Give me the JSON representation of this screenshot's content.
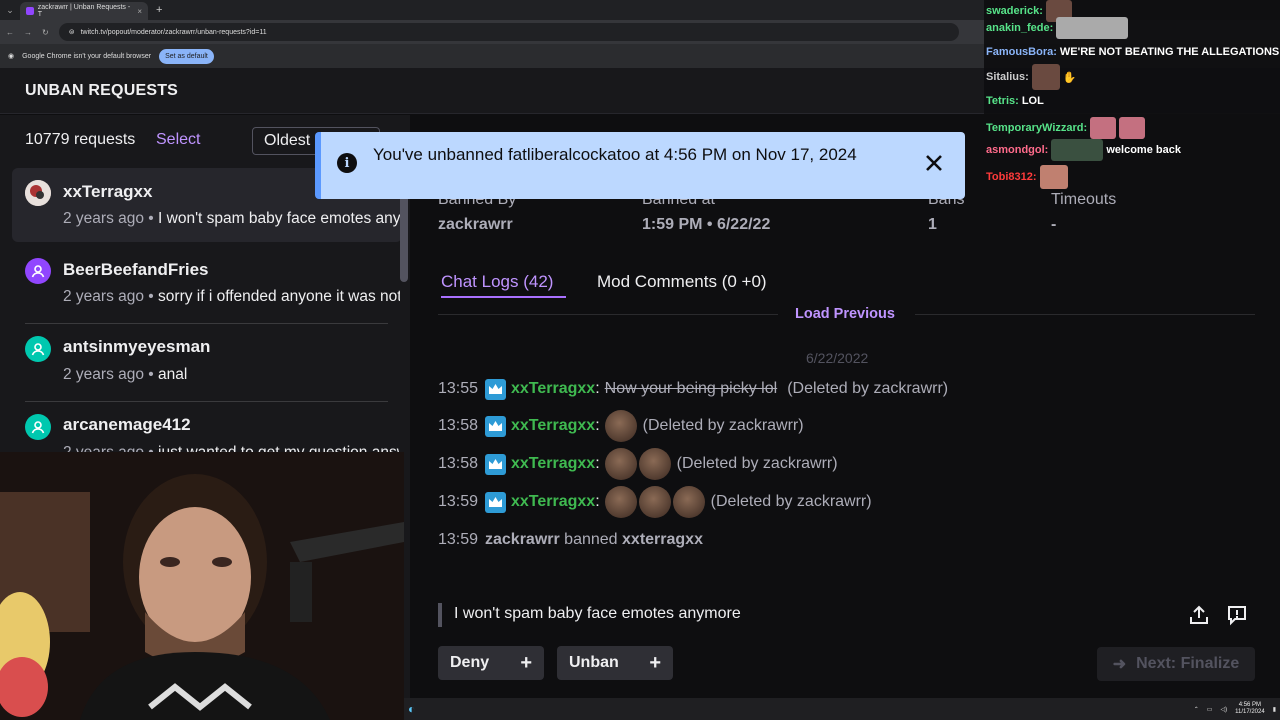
{
  "browser": {
    "tab_title": "zackrawrr | Unban Requests - T",
    "tab_close": "×",
    "new_tab": "+",
    "url": "twitch.tv/popout/moderator/zackrawrr/unban-requests?id=11",
    "info_text": "Google Chrome isn't your default browser",
    "set_default_label": "Set as default"
  },
  "page": {
    "title": "UNBAN REQUESTS"
  },
  "list": {
    "count": "10779 requests",
    "select_label": "Select",
    "sort_label": "Oldest",
    "items": [
      {
        "name": "xxTerragxx",
        "time": "2 years ago",
        "message": "I won't spam baby face emotes anymore"
      },
      {
        "name": "BeerBeefandFries",
        "time": "2 years ago",
        "message": "sorry if i offended anyone it was not my intention"
      },
      {
        "name": "antsinmyeyesman",
        "time": "2 years ago",
        "message": "anal"
      },
      {
        "name": "arcanemage412",
        "time": "2 years ago",
        "message": "just wanted to get my question answered"
      }
    ]
  },
  "details": {
    "banned_by_label": "Banned By",
    "banned_by": "zackrawrr",
    "banned_at_label": "Banned at",
    "banned_at": "1:59 PM • 6/22/22",
    "bans_label": "Bans",
    "bans": "1",
    "timeouts_label": "Timeouts",
    "timeouts": "-"
  },
  "tabs": {
    "chat_logs": "Chat Logs (42)",
    "mod_comments": "Mod Comments (0 +0)"
  },
  "logs": {
    "load_previous": "Load Previous",
    "date": "6/22/2022",
    "rows": [
      {
        "time": "13:55",
        "user": "xxTerragxx",
        "text": "Now your being picky lol",
        "deleted": "(Deleted by zackrawrr)"
      },
      {
        "time": "13:58",
        "user": "xxTerragxx",
        "deleted": "(Deleted by zackrawrr)"
      },
      {
        "time": "13:58",
        "user": "xxTerragxx",
        "deleted": "(Deleted by zackrawrr)"
      },
      {
        "time": "13:59",
        "user": "xxTerragxx",
        "deleted": "(Deleted by zackrawrr)"
      }
    ],
    "ban_time": "13:59",
    "ban_actor": "zackrawrr",
    "ban_verb": "banned",
    "ban_target": "xxterragxx"
  },
  "request_message": "I won't spam baby face emotes anymore",
  "actions": {
    "deny": "Deny",
    "unban": "Unban",
    "next": "Next: Finalize"
  },
  "toast": {
    "message": "You've unbanned fatliberalcockatoo at 4:56 PM on Nov 17, 2024"
  },
  "chat": [
    {
      "user": "swaderick:",
      "color": "#57e389",
      "msg": ""
    },
    {
      "user": "anakin_fede:",
      "color": "#57e389",
      "msg": ""
    },
    {
      "user": "FamousBora:",
      "color": "#8ab4f8",
      "msg": "WE'RE NOT BEATING THE ALLEGATIONS"
    },
    {
      "user": "Sitalius:",
      "color": "#cccccc",
      "msg": ""
    },
    {
      "user": "Tetris:",
      "color": "#57e389",
      "msg": "LOL"
    },
    {
      "user": "TemporaryWizzard:",
      "color": "#57e389",
      "msg": ""
    },
    {
      "user": "asmondgol:",
      "color": "#ff6b8b",
      "msg": "welcome back"
    },
    {
      "user": "Tobi8312:",
      "color": "#ff3b3b",
      "msg": ""
    }
  ],
  "taskbar": {
    "time": "4:56 PM",
    "date": "11/17/2024"
  },
  "colors": {
    "accent": "#bf94ff",
    "toast_bg": "#bcd8ff",
    "username_green": "#3fb950",
    "badge_blue": "#2e9bd6"
  }
}
